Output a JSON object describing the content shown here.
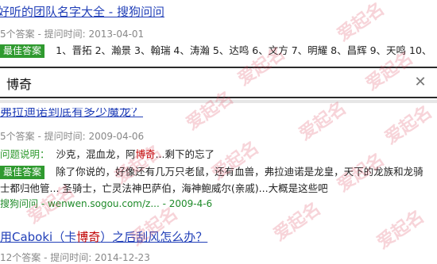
{
  "results": [
    {
      "title": "好听的团队名字大全 - 搜狗问问",
      "meta": "5个答案 - 提问时间: 2013-04-01",
      "best_label": "最佳答案",
      "snippet": "1、晋拓 2、瀚景 3、翰瑞 4、涛瀚 5、达鸣 6、文方 7、明耀 8、昌辉 9、天鸣 10、"
    },
    {
      "title": "弗拉迪诺到底有多少魔龙？",
      "meta": "5个答案 - 提问时间: 2009-04-06",
      "question_label": "问题说明：",
      "question_pre": "沙克，混血龙，阿",
      "question_hl": "博奇",
      "question_post": "...剩下的忘了",
      "best_label": "最佳答案",
      "answer_line1": "除了你说的，好像还有几万只老鼠，还有血兽，弗拉迪诺是龙皇，天下的龙族和龙骑",
      "answer_line2": "士都归他管... 圣骑士，亡灵法神巴萨伯，海神鲍威尔(亲戚)...大概是这些吧",
      "source": "搜狗问问 - wenwen.sogou.com/z... - 2009-4-6"
    },
    {
      "title_pre": "用Caboki（卡",
      "title_hl": "博奇",
      "title_post": "）之后刮风怎么办？",
      "meta": "12个答案 - 提问时间: 2014-12-23"
    }
  ],
  "search": {
    "query": "博奇"
  },
  "watermark": "爱起名",
  "colors": {
    "link": "#2240b8",
    "badge": "#2f9a2f",
    "highlight": "#c00000",
    "source": "#1f8b2a"
  }
}
